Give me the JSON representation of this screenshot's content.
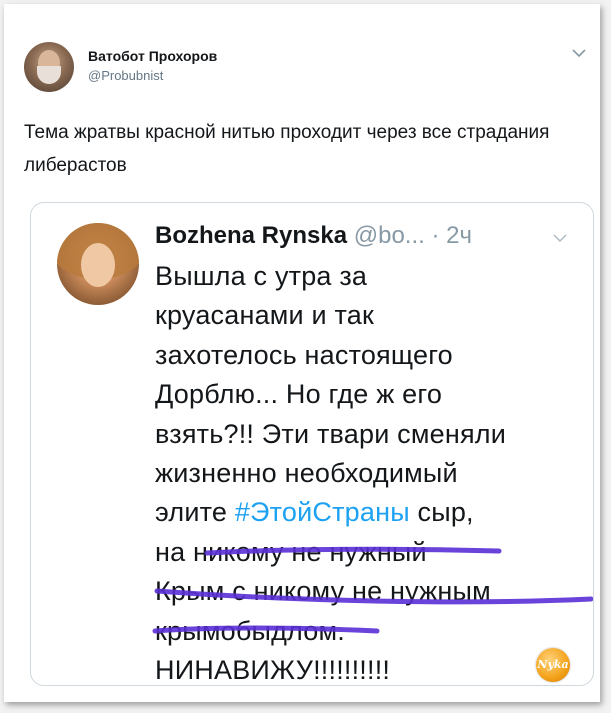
{
  "tweet": {
    "author_name": "Ватобот Прохоров",
    "author_handle": "@Probubnist",
    "avatar_icon": "user-avatar",
    "text": "Тема жратвы красной нитью проходит через все страдания либерастов"
  },
  "quoted_tweet": {
    "author_name": "Bozhena Rynska",
    "handle_truncated": "@bo...",
    "time": "· 2ч",
    "avatar_icon": "user-avatar",
    "lines": {
      "l1": "Вышла с утра за",
      "l2": "круасанами и так",
      "l3": "захотелось настоящего",
      "l4": "Дорблю... Но где ж его",
      "l5": "взять?!! Эти твари сменяли",
      "l6": "жизненно необходимый",
      "l7_pre": "элите ",
      "l7_hashtag": "#ЭтойСтраны",
      "l7_post": " сыр,",
      "l8": "на никому не нужный",
      "l9": "Крым с никому не нужным",
      "l10": "крымобыдлом.",
      "l11": "НИНАВИЖУ!!!!!!!!!!"
    }
  },
  "colors": {
    "hashtag": "#1da1f2",
    "handwritten_underline": "#5a2fd6",
    "meta_text": "#657786"
  },
  "watermark": {
    "text": "Nyka",
    "icon": "site-logo-watermark"
  }
}
